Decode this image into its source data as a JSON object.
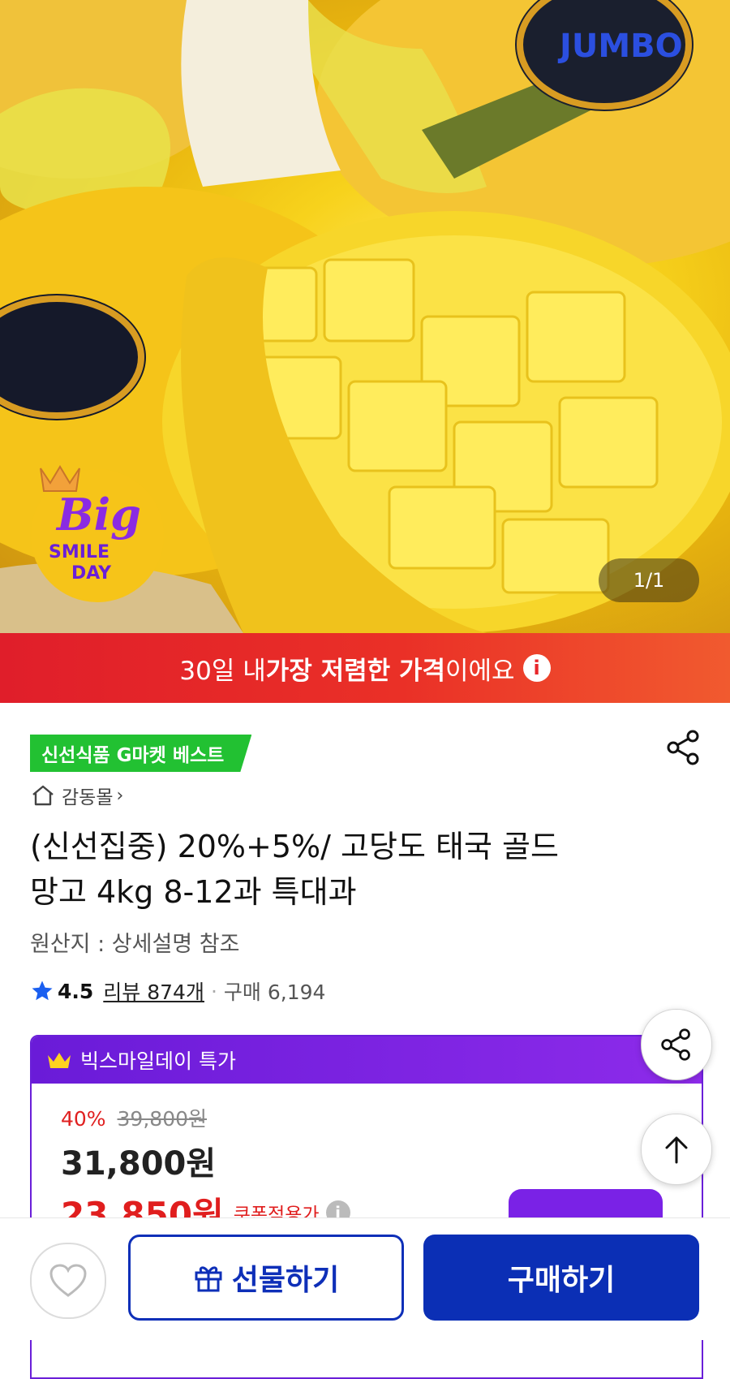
{
  "hero": {
    "counter": "1/1",
    "badge": {
      "big": "Big",
      "smile": "SMILE",
      "day": "DAY"
    },
    "sticker_brand": "JUMBO"
  },
  "banner": {
    "pre": "30일 내 ",
    "bold": "가장 저렴한 가격",
    "post": "이에요",
    "info": "i"
  },
  "product": {
    "best_tag": "신선식품 G마켓 베스트",
    "store": "감동몰",
    "store_chevron": "›",
    "title_line1": "(신선집중) 20%+5%/ 고당도 태국 골드",
    "title_line2": "망고 4kg 8-12과 특대과",
    "origin": "원산지 : 상세설명 참조",
    "rating": "4.5",
    "reviews": "리뷰 874개",
    "separator": "·",
    "purchases": "구매 6,194"
  },
  "deal": {
    "header": "빅스마일데이 특가",
    "discount": "40%",
    "original_price": "39,800원",
    "price": "31,800원",
    "coupon_price": "23,850원",
    "coupon_label": "쿠폰적용가",
    "coupon_info": "i"
  },
  "bottom": {
    "gift": "선물하기",
    "buy": "구매하기"
  },
  "colors": {
    "brand_blue": "#0b2fb5",
    "deal_purple": "#7a22e6",
    "sale_red": "#e01e1e",
    "best_green": "#22c132"
  }
}
